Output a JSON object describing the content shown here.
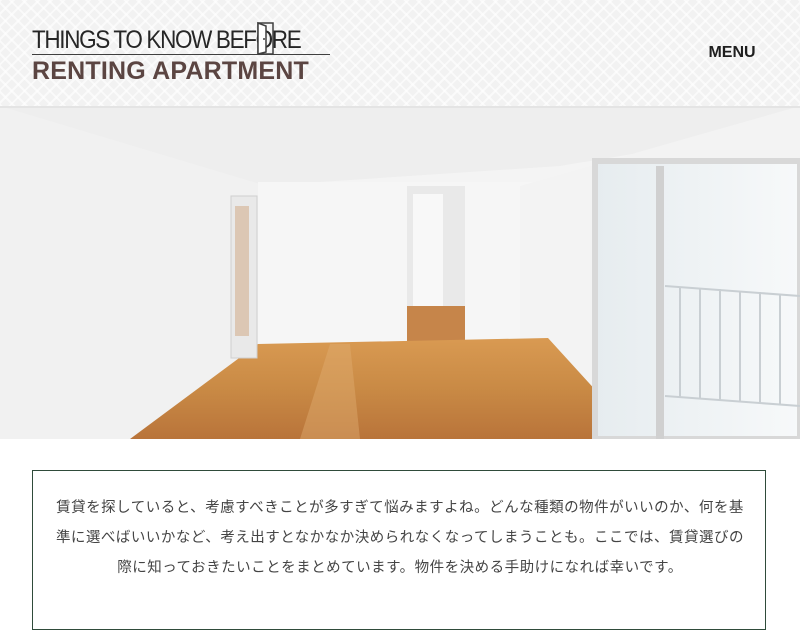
{
  "header": {
    "logo_line1": "THINGS TO KNOW BEFORE",
    "logo_line2": "RENTING APARTMENT",
    "menu_label": "MENU"
  },
  "hero": {
    "image": "empty-apartment-room-photo"
  },
  "intro": {
    "text": "賃貸を探していると、考慮すべきことが多すぎて悩みますよね。どんな種類の物件がいいのか、何を基準に選べばいいかなど、考え出すとなかなか決められなくなってしまうことも。ここでは、賃貸選びの際に知っておきたいことをまとめています。物件を決める手助けになれば幸いです。"
  },
  "colors": {
    "logo_dark": "#262626",
    "logo_brown": "#5b4542",
    "box_border": "#2f4b3a",
    "floor_wood": "#c98a45"
  }
}
